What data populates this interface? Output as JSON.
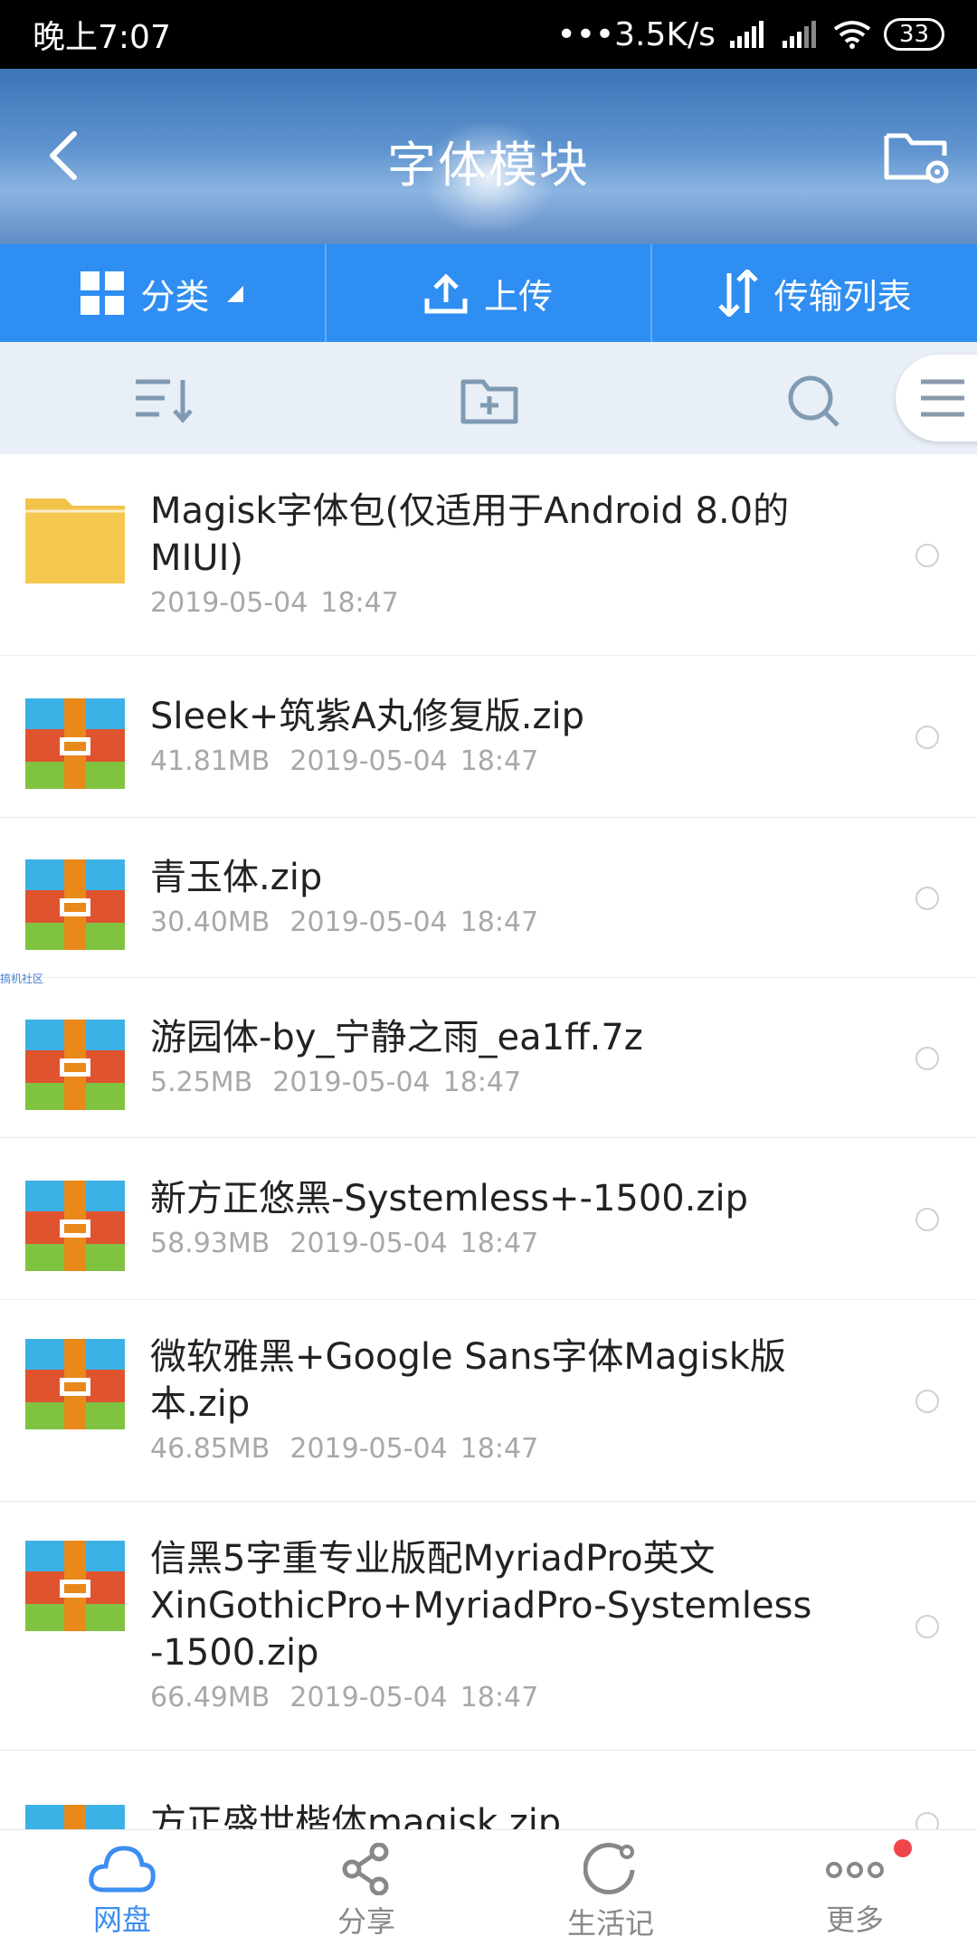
{
  "status_bar": {
    "time": "晚上7:07",
    "net_speed": "•••3.5K/s",
    "battery": "33"
  },
  "header": {
    "title": "字体模块"
  },
  "actions": [
    {
      "label": "分类",
      "icon": "grid-icon"
    },
    {
      "label": "上传",
      "icon": "upload-icon"
    },
    {
      "label": "传输列表",
      "icon": "transfer-icon"
    }
  ],
  "files": [
    {
      "name": "Magisk字体包(仅适用于Android 8.0的MIUI)",
      "name_lines": [
        "Magisk字体包(仅适用于Android 8.0的",
        "MIUI)"
      ],
      "size": "",
      "date": "2019-05-04",
      "time": "18:47",
      "type": "folder"
    },
    {
      "name_lines": [
        "Sleek+筑紫A丸修复版.zip"
      ],
      "size": "41.81MB",
      "date": "2019-05-04",
      "time": "18:47",
      "type": "archive"
    },
    {
      "name_lines": [
        "青玉体.zip"
      ],
      "size": "30.40MB",
      "date": "2019-05-04",
      "time": "18:47",
      "type": "archive"
    },
    {
      "name_lines": [
        "游园体-by_宁静之雨_ea1ff.7z"
      ],
      "size": "5.25MB",
      "date": "2019-05-04",
      "time": "18:47",
      "type": "archive"
    },
    {
      "name_lines": [
        "新方正悠黑-Systemless+-1500.zip"
      ],
      "size": "58.93MB",
      "date": "2019-05-04",
      "time": "18:47",
      "type": "archive"
    },
    {
      "name_lines": [
        "微软雅黑+Google Sans字体Magisk版",
        "本.zip"
      ],
      "size": "46.85MB",
      "date": "2019-05-04",
      "time": "18:47",
      "type": "archive"
    },
    {
      "name_lines": [
        "信黑5字重专业版配MyriadPro英文",
        "XinGothicPro+MyriadPro-Systemless",
        "-1500.zip"
      ],
      "size": "66.49MB",
      "date": "2019-05-04",
      "time": "18:47",
      "type": "archive"
    },
    {
      "name_lines": [
        "方正盛世楷体magisk.zip"
      ],
      "size": "",
      "date": "",
      "time": "",
      "type": "archive"
    }
  ],
  "watermark": "搞机社区",
  "bottom_nav": [
    {
      "label": "网盘",
      "icon": "cloud-icon",
      "active": true
    },
    {
      "label": "分享",
      "icon": "share-icon",
      "active": false
    },
    {
      "label": "生活记",
      "icon": "refresh-circle-icon",
      "active": false
    },
    {
      "label": "更多",
      "icon": "more-icon",
      "active": false
    }
  ],
  "colors": {
    "accent": "#2f8ef2",
    "nav_active": "#3d8ef0",
    "nav_inactive": "#888888",
    "badge": "#f0464a"
  }
}
